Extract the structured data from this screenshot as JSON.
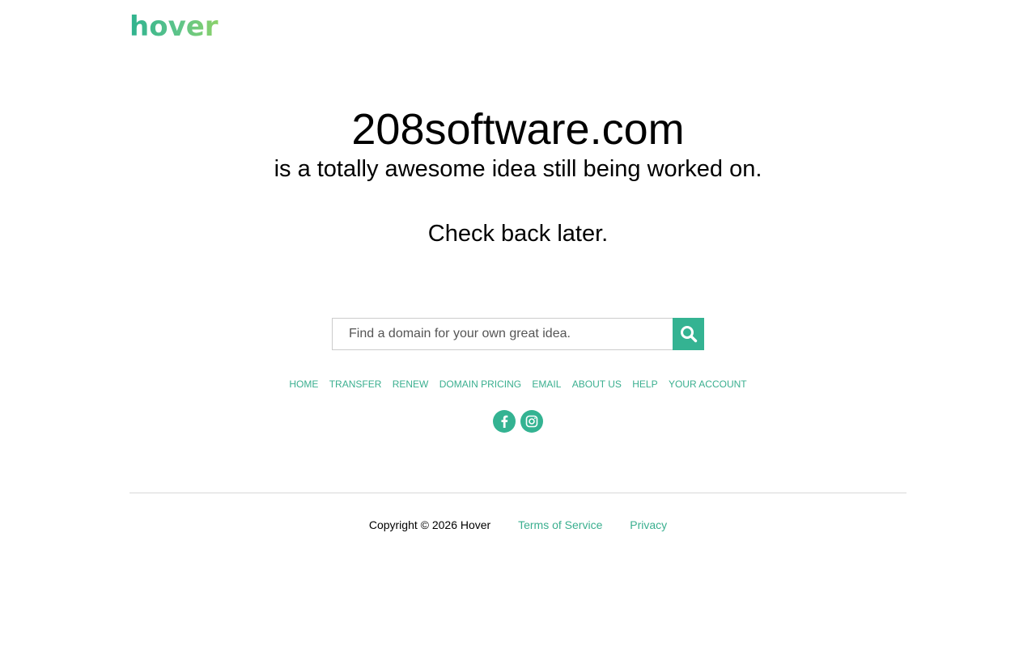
{
  "header": {
    "logo_text": "hover"
  },
  "hero": {
    "domain": "208software.com",
    "tagline": "is a totally awesome idea still being worked on.",
    "cta": "Check back later."
  },
  "search": {
    "placeholder": "Find a domain for your own great idea.",
    "button_icon": "search-icon"
  },
  "nav": {
    "items": [
      {
        "label": "HOME"
      },
      {
        "label": "TRANSFER"
      },
      {
        "label": "RENEW"
      },
      {
        "label": "DOMAIN PRICING"
      },
      {
        "label": "EMAIL"
      },
      {
        "label": "ABOUT US"
      },
      {
        "label": "HELP"
      },
      {
        "label": "YOUR ACCOUNT"
      }
    ]
  },
  "social": {
    "icons": [
      "facebook-icon",
      "instagram-icon"
    ]
  },
  "footer": {
    "copyright": "Copyright © 2026 Hover",
    "terms": "Terms of Service",
    "privacy": "Privacy"
  },
  "colors": {
    "accent": "#34b392",
    "link": "#3aaf8f",
    "divider": "#d8d8d8"
  }
}
